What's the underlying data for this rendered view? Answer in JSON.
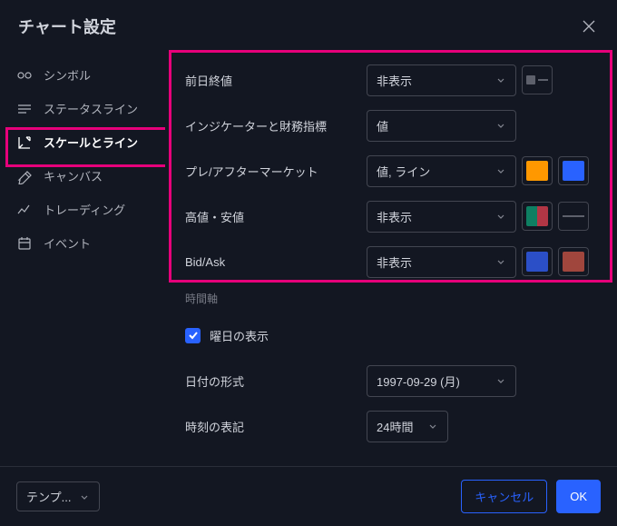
{
  "title": "チャート設定",
  "sidebar": [
    {
      "label": "シンボル"
    },
    {
      "label": "ステータスライン"
    },
    {
      "label": "スケールとライン"
    },
    {
      "label": "キャンバス"
    },
    {
      "label": "トレーディング"
    },
    {
      "label": "イベント"
    }
  ],
  "rows": {
    "prevClose": {
      "label": "前日終値",
      "value": "非表示"
    },
    "indicators": {
      "label": "インジケーターと財務指標",
      "value": "値"
    },
    "prepost": {
      "label": "プレ/アフターマーケット",
      "value": "値, ライン"
    },
    "highlow": {
      "label": "高値・安値",
      "value": "非表示"
    },
    "bidask": {
      "label": "Bid/Ask",
      "value": "非表示"
    }
  },
  "timeaxis": {
    "heading": "時間軸",
    "dayOfWeek": "曜日の表示",
    "dateFormat": {
      "label": "日付の形式",
      "value": "1997-09-29 (月)"
    },
    "timeFormat": {
      "label": "時刻の表記",
      "value": "24時間"
    }
  },
  "footer": {
    "template": "テンプ...",
    "cancel": "キャンセル",
    "ok": "OK"
  },
  "colors": {
    "prevCloseLine": "#5d606b",
    "prepost1": "#ff9800",
    "prepost2": "#2962ff",
    "highlow1a": "#0e7f62",
    "highlow1b": "#b23645",
    "highlowLine": "#5d606b",
    "bidask1": "#2962ff",
    "bidask2": "#b24a3f"
  }
}
